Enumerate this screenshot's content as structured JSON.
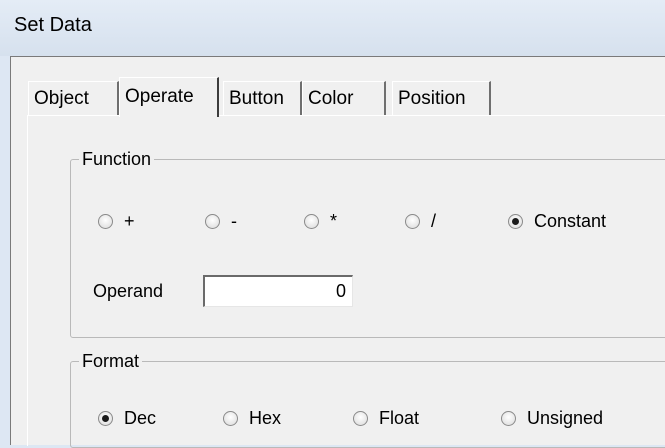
{
  "window": {
    "title": "Set Data"
  },
  "tabs": [
    {
      "label": "Object"
    },
    {
      "label": "Operate"
    },
    {
      "label": "Button"
    },
    {
      "label": "Color"
    },
    {
      "label": "Position"
    }
  ],
  "active_tab": "Operate",
  "function_group": {
    "legend": "Function",
    "options": [
      {
        "label": "+",
        "checked": false
      },
      {
        "label": "-",
        "checked": false
      },
      {
        "label": "*",
        "checked": false
      },
      {
        "label": "/",
        "checked": false
      },
      {
        "label": "Constant",
        "checked": true
      }
    ],
    "operand_label": "Operand",
    "operand_value": "0"
  },
  "format_group": {
    "legend": "Format",
    "options": [
      {
        "label": "Dec",
        "checked": true
      },
      {
        "label": "Hex",
        "checked": false
      },
      {
        "label": "Float",
        "checked": false
      },
      {
        "label": "Unsigned",
        "checked": false
      }
    ]
  }
}
